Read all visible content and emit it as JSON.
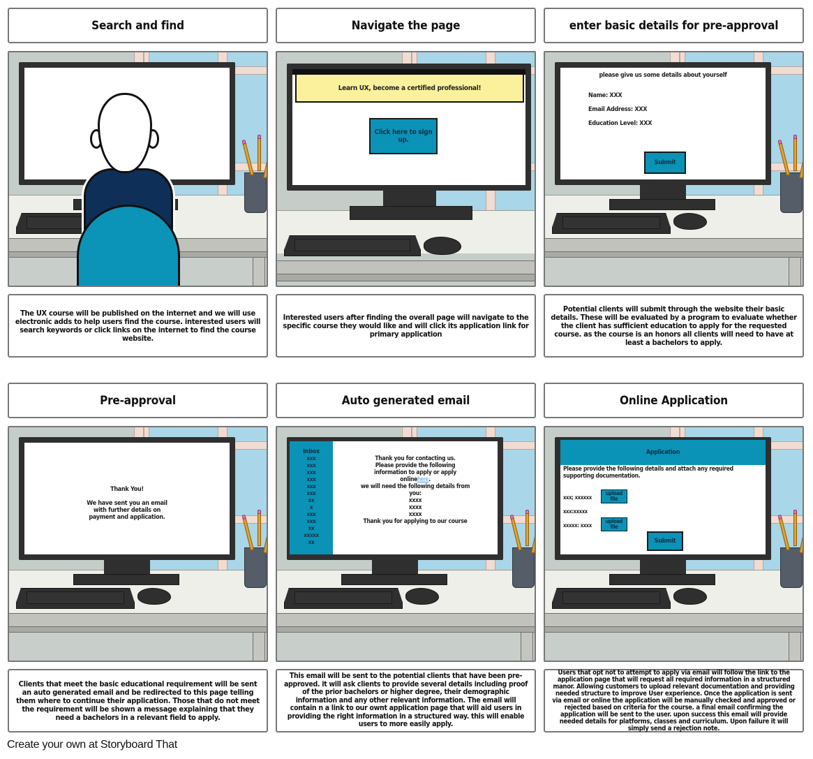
{
  "storyboard": {
    "panels": [
      {
        "title": "Search and find",
        "description": "The UX course will be published on the internet and we will use electronic adds to help users find the course. interested users will search keywords or click links on the internet to find the course website.",
        "screen": {}
      },
      {
        "title": "Navigate the page",
        "description": "Interested users after finding the overall page will navigate to the specific course they would like and will click its application link for primary application",
        "screen": {
          "banner": "Learn UX, become a certified professional!",
          "signup_button": "Click here to sign up."
        }
      },
      {
        "title": "enter basic details for pre-approval",
        "description": "Potential clients will submit through the website their basic details. These will be evaluated by a program to evaluate whether the client has sufficient education to apply for the requested course. as the course is an honors all clients will need to have at least a bachelors to apply.",
        "screen": {
          "heading": "please give us some details about yourself",
          "fields": [
            {
              "label": "Name: XXX"
            },
            {
              "label": "Email Address: XXX"
            },
            {
              "label": "Education Level: XXX"
            }
          ],
          "submit": "Submit"
        }
      },
      {
        "title": "Pre-approval",
        "description": "Clients that meet the basic educational requirement will be sent an auto generated email and be redirected to this page telling them where to continue their application. Those that do not meet the requirement will be shown a message explaining that they need a bachelors in a relevant field to apply.",
        "screen": {
          "heading": "Thank You!",
          "message": "We have sent you an email with further details on payment and application."
        }
      },
      {
        "title": "Auto generated email",
        "description": "This email will be sent to the potential clients that have been pre-approved. it will ask clients to provide several details including proof of the prior bachelors or higher degree, their demographic information and any other relevant information. The email will contain n a link to our ownt application page that will aid users in providing the right information in a structured way. this will enable users to more easily apply.",
        "screen": {
          "inbox_label": "Inbox",
          "inbox_items": [
            "xxx",
            "xxx",
            "xxx",
            "xxx",
            "xxx",
            "xxx",
            "xx",
            "x",
            "xxx",
            "xxx",
            "xx",
            "xxxxx",
            "xx"
          ],
          "line1": "Thank you for contacting us.",
          "line2": "Please provide the following",
          "line3": "information to apply or apply",
          "line4_prefix": "online",
          "link_text": "here",
          "line4_suffix": ".",
          "line5": "we will need the following details from",
          "line6": "you:",
          "details": [
            "xxxx",
            "xxxx",
            "xxxx"
          ],
          "closing": "Thank you for applying to our course"
        }
      },
      {
        "title": "Online Application",
        "description": "Users that opt not to attempt to apply via email will follow the link to the application page that will request all required information in a structured manor. Allowing customers to upload relevant documentation and providing needed structure to improve User experience. Once the application is sent via email or online the application will be manually checked and approved or rejected based on criteria for the course. a final email confirming the application will be sent to the user. upon success this email will provide needed details for platforms, classes and curriculum. Upon failure it will simply send a rejection note.",
        "screen": {
          "header": "Application",
          "instructions": "Please provide the following details and attach any required supporting documentation.",
          "rows": [
            {
              "label": "xxx; xxxxxx",
              "upload": "upload file"
            },
            {
              "label": "xxx:xxxxx",
              "upload": null
            },
            {
              "label": "xxxxx: xxxx",
              "upload": "upload file"
            }
          ],
          "submit": "Submit"
        }
      }
    ]
  },
  "colors": {
    "teal": "#0a93b7",
    "banner_yellow": "#fbf19c",
    "link_blue": "#4f9fd6",
    "shirt_navy": "#0e2f57"
  },
  "footer": {
    "credit": "Create your own at Storyboard That"
  }
}
